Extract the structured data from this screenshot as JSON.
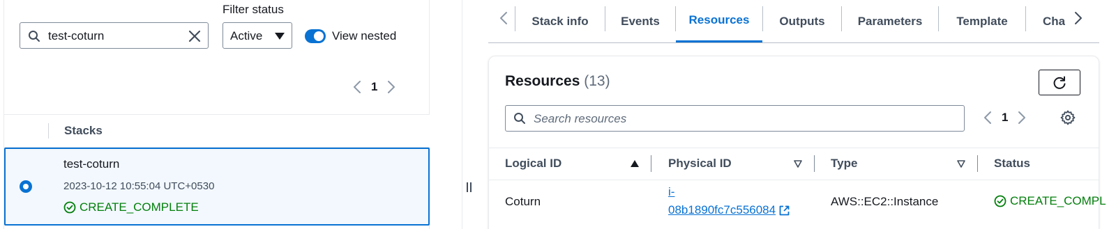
{
  "left": {
    "filter_label": "Filter status",
    "search_value": "test-coturn",
    "status_selected": "Active",
    "view_nested_label": "View nested",
    "page_number": "1",
    "column_header": "Stacks",
    "stack": {
      "name": "test-coturn",
      "timestamp": "2023-10-12 10:55:04 UTC+0530",
      "status": "CREATE_COMPLETE"
    }
  },
  "tabs": [
    {
      "label": "Stack info"
    },
    {
      "label": "Events"
    },
    {
      "label": "Resources"
    },
    {
      "label": "Outputs"
    },
    {
      "label": "Parameters"
    },
    {
      "label": "Template"
    },
    {
      "label": "Cha"
    }
  ],
  "resources": {
    "title": "Resources",
    "count": "(13)",
    "search_placeholder": "Search resources",
    "page_number": "1",
    "columns": {
      "logical_id": "Logical ID",
      "physical_id": "Physical ID",
      "type": "Type",
      "status": "Status"
    },
    "rows": [
      {
        "logical_id": "Coturn",
        "physical_id_line1": "i-",
        "physical_id_line2": "08b1890fc7c556084",
        "type": "AWS::EC2::Instance",
        "status": "CREATE_COMPL"
      }
    ]
  },
  "colors": {
    "accent": "#0972d3",
    "success": "#037f0c",
    "text": "#16191f",
    "muted": "#414d5c"
  }
}
